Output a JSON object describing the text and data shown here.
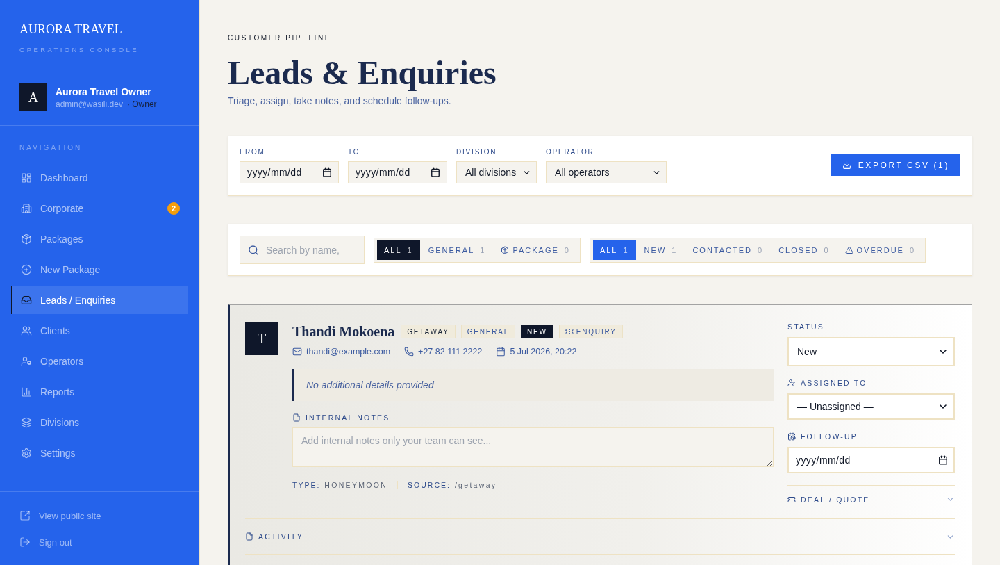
{
  "sidebar": {
    "brand": "AURORA TRAVEL",
    "tagline": "OPERATIONS CONSOLE",
    "user": {
      "initial": "A",
      "name": "Aurora Travel Owner",
      "email": "admin@wasili.dev",
      "role": "· Owner"
    },
    "nav_heading": "NAVIGATION",
    "items": [
      {
        "label": "Dashboard",
        "kind": "dashboard",
        "selected": false
      },
      {
        "label": "Corporate",
        "kind": "corporate",
        "selected": false,
        "badge": "2"
      },
      {
        "label": "Packages",
        "kind": "packages",
        "selected": false
      },
      {
        "label": "New Package",
        "kind": "new_package",
        "selected": false
      },
      {
        "label": "Leads / Enquiries",
        "kind": "leads",
        "selected": true
      },
      {
        "label": "Clients",
        "kind": "clients",
        "selected": false
      },
      {
        "label": "Operators",
        "kind": "operators",
        "selected": false
      },
      {
        "label": "Reports",
        "kind": "reports",
        "selected": false
      },
      {
        "label": "Divisions",
        "kind": "divisions",
        "selected": false
      },
      {
        "label": "Settings",
        "kind": "settings",
        "selected": false
      }
    ],
    "footer_links": [
      {
        "label": "View public site",
        "kind": "external"
      },
      {
        "label": "Sign out",
        "kind": "signout"
      }
    ]
  },
  "header": {
    "eyebrow": "CUSTOMER PIPELINE",
    "title": "Leads & Enquiries",
    "subtitle": "Triage, assign, take notes, and schedule follow-ups."
  },
  "filters": {
    "fields": [
      {
        "label": "FROM",
        "kind": "date",
        "placeholder": "yyyy/mm/dd"
      },
      {
        "label": "TO",
        "kind": "date",
        "placeholder": "yyyy/mm/dd"
      },
      {
        "label": "DIVISION",
        "kind": "select",
        "value": "All divisions"
      },
      {
        "label": "OPERATOR",
        "kind": "select",
        "value": "All operators"
      }
    ],
    "export_button": "EXPORT CSV (1)"
  },
  "list_controls": {
    "search": {
      "placeholder": "Search by name,"
    },
    "type_filter": {
      "kind": "type",
      "options": [
        {
          "label": "ALL",
          "count": "1",
          "kind": "all",
          "selected": true
        },
        {
          "label": "GENERAL",
          "count": "1",
          "kind": "general",
          "selected": false
        },
        {
          "label": "PACKAGE",
          "count": "0",
          "kind": "package",
          "selected": false
        }
      ]
    },
    "status_filter": {
      "kind": "status",
      "options": [
        {
          "label": "ALL",
          "count": "1",
          "kind": "all",
          "selected": true
        },
        {
          "label": "NEW",
          "count": "1",
          "kind": "new",
          "selected": false
        },
        {
          "label": "CONTACTED",
          "count": "0",
          "kind": "contacted",
          "selected": false
        },
        {
          "label": "CLOSED",
          "count": "0",
          "kind": "closed",
          "selected": false
        },
        {
          "label": "OVERDUE",
          "count": "0",
          "kind": "overdue",
          "selected": false
        }
      ]
    }
  },
  "lead": {
    "initial": "T",
    "name": "Thandi Mokoena",
    "tags": [
      {
        "label": "GETAWAY",
        "kind": "division"
      },
      {
        "label": "GENERAL",
        "kind": "category"
      },
      {
        "label": "NEW",
        "kind": "status"
      },
      {
        "label": "ENQUIRY",
        "kind": "channel"
      }
    ],
    "contacts": [
      {
        "kind": "email",
        "text": "thandi@example.com"
      },
      {
        "kind": "phone",
        "text": "+27 82 111 2222"
      },
      {
        "kind": "date",
        "text": "5 Jul 2026, 20:22"
      }
    ],
    "details": "No additional details provided",
    "notes": {
      "label": "INTERNAL NOTES",
      "placeholder": "Add internal notes only your team can see..."
    },
    "meta": [
      {
        "label": "TYPE:",
        "value": "HONEYMOON"
      },
      {
        "label": "SOURCE:",
        "value": "/getaway"
      }
    ],
    "status": {
      "label": "STATUS",
      "value": "New"
    },
    "assignee": {
      "label": "ASSIGNED TO",
      "value": "— Unassigned —"
    },
    "follow_up": {
      "label": "FOLLOW-UP",
      "placeholder": "yyyy/mm/dd"
    },
    "sections": [
      {
        "label": "DEAL / QUOTE",
        "expanded": false
      }
    ],
    "activity": {
      "label": "ACTIVITY",
      "expanded": false
    }
  }
}
